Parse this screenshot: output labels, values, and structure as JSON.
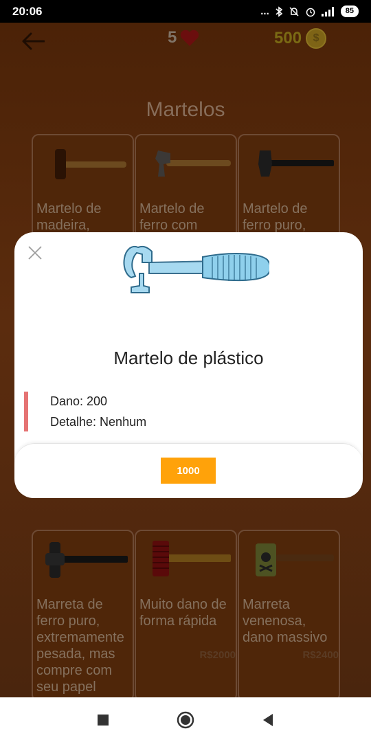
{
  "status_bar": {
    "time": "20:06",
    "dots": "...",
    "battery": "85"
  },
  "header": {
    "lives": "5",
    "coins": "500",
    "coin_symbol": "$"
  },
  "section": {
    "title": "Martelos"
  },
  "shop_items": [
    {
      "desc": "Martelo de madeira,",
      "price": ""
    },
    {
      "desc": "Martelo de ferro com",
      "price": ""
    },
    {
      "desc": "Martelo de ferro puro,",
      "price": ""
    },
    {
      "desc": "Marreta de ferro puro, extremamente pesada, mas compre com seu papel",
      "price": ""
    },
    {
      "desc": "Muito dano de forma rápida",
      "price": "R$2000"
    },
    {
      "desc": "Marreta venenosa, dano massivo",
      "price": "R$2400"
    }
  ],
  "modal": {
    "title": "Martelo de plástico",
    "damage": "Dano: 200",
    "detail": "Detalhe: Nenhum",
    "buy_label": "1000",
    "accent_color": "#e57373",
    "button_color": "#ffa20a"
  }
}
